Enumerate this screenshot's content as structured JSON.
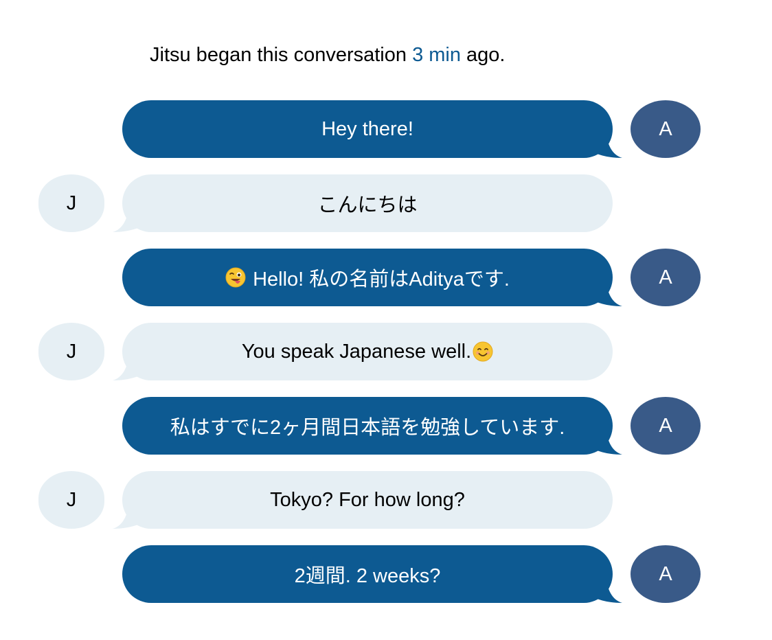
{
  "header": {
    "prefix": "Jitsu began this conversation ",
    "time": "3 min",
    "suffix": " ago."
  },
  "colors": {
    "outgoing_bubble": "#0d5a92",
    "outgoing_avatar": "#395a88",
    "incoming_bubble": "#e6eff4",
    "link": "#0d5a92"
  },
  "messages": [
    {
      "sender": "outgoing",
      "avatar": "A",
      "text": "Hey there!"
    },
    {
      "sender": "incoming",
      "avatar": "J",
      "text": "こんにちは"
    },
    {
      "sender": "outgoing",
      "avatar": "A",
      "text": "Hello! 私の名前はAdityaです.",
      "emoji": "winking-face-with-tongue-icon"
    },
    {
      "sender": "incoming",
      "avatar": "J",
      "text": "You speak Japanese well.",
      "emoji": "smiling-face-icon"
    },
    {
      "sender": "outgoing",
      "avatar": "A",
      "text": "私はすでに2ヶ月間日本語を勉強しています."
    },
    {
      "sender": "incoming",
      "avatar": "J",
      "text": "Tokyo? For how long?"
    },
    {
      "sender": "outgoing",
      "avatar": "A",
      "text": "2週間. 2 weeks?"
    }
  ]
}
